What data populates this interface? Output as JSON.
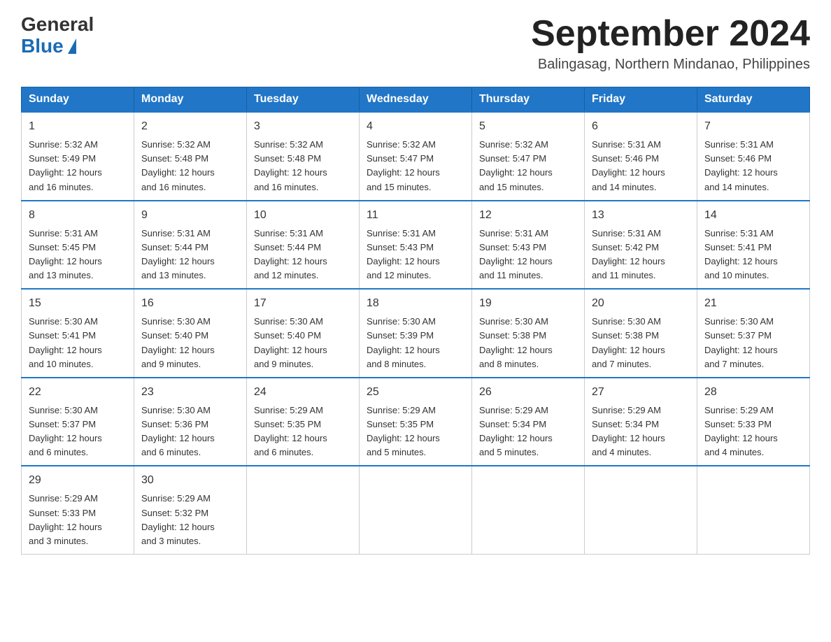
{
  "header": {
    "logo_general": "General",
    "logo_blue": "Blue",
    "month_title": "September 2024",
    "location": "Balingasag, Northern Mindanao, Philippines"
  },
  "days_of_week": [
    "Sunday",
    "Monday",
    "Tuesday",
    "Wednesday",
    "Thursday",
    "Friday",
    "Saturday"
  ],
  "weeks": [
    [
      {
        "day": "1",
        "sunrise": "5:32 AM",
        "sunset": "5:49 PM",
        "daylight": "12 hours and 16 minutes."
      },
      {
        "day": "2",
        "sunrise": "5:32 AM",
        "sunset": "5:48 PM",
        "daylight": "12 hours and 16 minutes."
      },
      {
        "day": "3",
        "sunrise": "5:32 AM",
        "sunset": "5:48 PM",
        "daylight": "12 hours and 16 minutes."
      },
      {
        "day": "4",
        "sunrise": "5:32 AM",
        "sunset": "5:47 PM",
        "daylight": "12 hours and 15 minutes."
      },
      {
        "day": "5",
        "sunrise": "5:32 AM",
        "sunset": "5:47 PM",
        "daylight": "12 hours and 15 minutes."
      },
      {
        "day": "6",
        "sunrise": "5:31 AM",
        "sunset": "5:46 PM",
        "daylight": "12 hours and 14 minutes."
      },
      {
        "day": "7",
        "sunrise": "5:31 AM",
        "sunset": "5:46 PM",
        "daylight": "12 hours and 14 minutes."
      }
    ],
    [
      {
        "day": "8",
        "sunrise": "5:31 AM",
        "sunset": "5:45 PM",
        "daylight": "12 hours and 13 minutes."
      },
      {
        "day": "9",
        "sunrise": "5:31 AM",
        "sunset": "5:44 PM",
        "daylight": "12 hours and 13 minutes."
      },
      {
        "day": "10",
        "sunrise": "5:31 AM",
        "sunset": "5:44 PM",
        "daylight": "12 hours and 12 minutes."
      },
      {
        "day": "11",
        "sunrise": "5:31 AM",
        "sunset": "5:43 PM",
        "daylight": "12 hours and 12 minutes."
      },
      {
        "day": "12",
        "sunrise": "5:31 AM",
        "sunset": "5:43 PM",
        "daylight": "12 hours and 11 minutes."
      },
      {
        "day": "13",
        "sunrise": "5:31 AM",
        "sunset": "5:42 PM",
        "daylight": "12 hours and 11 minutes."
      },
      {
        "day": "14",
        "sunrise": "5:31 AM",
        "sunset": "5:41 PM",
        "daylight": "12 hours and 10 minutes."
      }
    ],
    [
      {
        "day": "15",
        "sunrise": "5:30 AM",
        "sunset": "5:41 PM",
        "daylight": "12 hours and 10 minutes."
      },
      {
        "day": "16",
        "sunrise": "5:30 AM",
        "sunset": "5:40 PM",
        "daylight": "12 hours and 9 minutes."
      },
      {
        "day": "17",
        "sunrise": "5:30 AM",
        "sunset": "5:40 PM",
        "daylight": "12 hours and 9 minutes."
      },
      {
        "day": "18",
        "sunrise": "5:30 AM",
        "sunset": "5:39 PM",
        "daylight": "12 hours and 8 minutes."
      },
      {
        "day": "19",
        "sunrise": "5:30 AM",
        "sunset": "5:38 PM",
        "daylight": "12 hours and 8 minutes."
      },
      {
        "day": "20",
        "sunrise": "5:30 AM",
        "sunset": "5:38 PM",
        "daylight": "12 hours and 7 minutes."
      },
      {
        "day": "21",
        "sunrise": "5:30 AM",
        "sunset": "5:37 PM",
        "daylight": "12 hours and 7 minutes."
      }
    ],
    [
      {
        "day": "22",
        "sunrise": "5:30 AM",
        "sunset": "5:37 PM",
        "daylight": "12 hours and 6 minutes."
      },
      {
        "day": "23",
        "sunrise": "5:30 AM",
        "sunset": "5:36 PM",
        "daylight": "12 hours and 6 minutes."
      },
      {
        "day": "24",
        "sunrise": "5:29 AM",
        "sunset": "5:35 PM",
        "daylight": "12 hours and 6 minutes."
      },
      {
        "day": "25",
        "sunrise": "5:29 AM",
        "sunset": "5:35 PM",
        "daylight": "12 hours and 5 minutes."
      },
      {
        "day": "26",
        "sunrise": "5:29 AM",
        "sunset": "5:34 PM",
        "daylight": "12 hours and 5 minutes."
      },
      {
        "day": "27",
        "sunrise": "5:29 AM",
        "sunset": "5:34 PM",
        "daylight": "12 hours and 4 minutes."
      },
      {
        "day": "28",
        "sunrise": "5:29 AM",
        "sunset": "5:33 PM",
        "daylight": "12 hours and 4 minutes."
      }
    ],
    [
      {
        "day": "29",
        "sunrise": "5:29 AM",
        "sunset": "5:33 PM",
        "daylight": "12 hours and 3 minutes."
      },
      {
        "day": "30",
        "sunrise": "5:29 AM",
        "sunset": "5:32 PM",
        "daylight": "12 hours and 3 minutes."
      },
      null,
      null,
      null,
      null,
      null
    ]
  ],
  "labels": {
    "sunrise": "Sunrise:",
    "sunset": "Sunset:",
    "daylight": "Daylight:"
  }
}
